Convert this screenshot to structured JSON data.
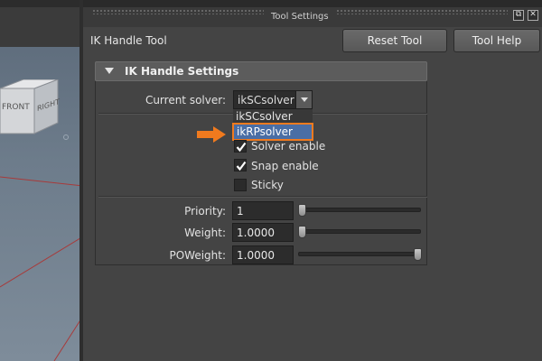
{
  "panel": {
    "title": "Tool Settings",
    "tool_name": "IK Handle Tool",
    "reset_button": "Reset Tool",
    "help_button": "Tool Help",
    "float_icon": "float-window-icon",
    "close_icon": "close-icon"
  },
  "viewport": {
    "cube_front": "FRONT",
    "cube_right": "RIGHT"
  },
  "settings": {
    "section_title": "IK Handle Settings",
    "solver_label": "Current solver:",
    "solver_value": "ikSCsolver",
    "solver_options": [
      "ikSCsolver",
      "ikRPsolver"
    ],
    "highlighted_option": "ikRPsolver",
    "checkboxes": [
      {
        "label": "Solver enable",
        "checked": true
      },
      {
        "label": "Snap enable",
        "checked": true
      },
      {
        "label": "Sticky",
        "checked": false
      }
    ],
    "fields": [
      {
        "label": "Priority:",
        "value": "1",
        "slider_fraction": 0.0
      },
      {
        "label": "Weight:",
        "value": "1.0000",
        "slider_fraction": 0.0
      },
      {
        "label": "POWeight:",
        "value": "1.0000",
        "slider_fraction": 1.0
      }
    ]
  },
  "colors": {
    "highlight_border": "#f07a1e",
    "highlight_fill": "#4a6ea5",
    "annotation_arrow": "#f07a1e"
  }
}
